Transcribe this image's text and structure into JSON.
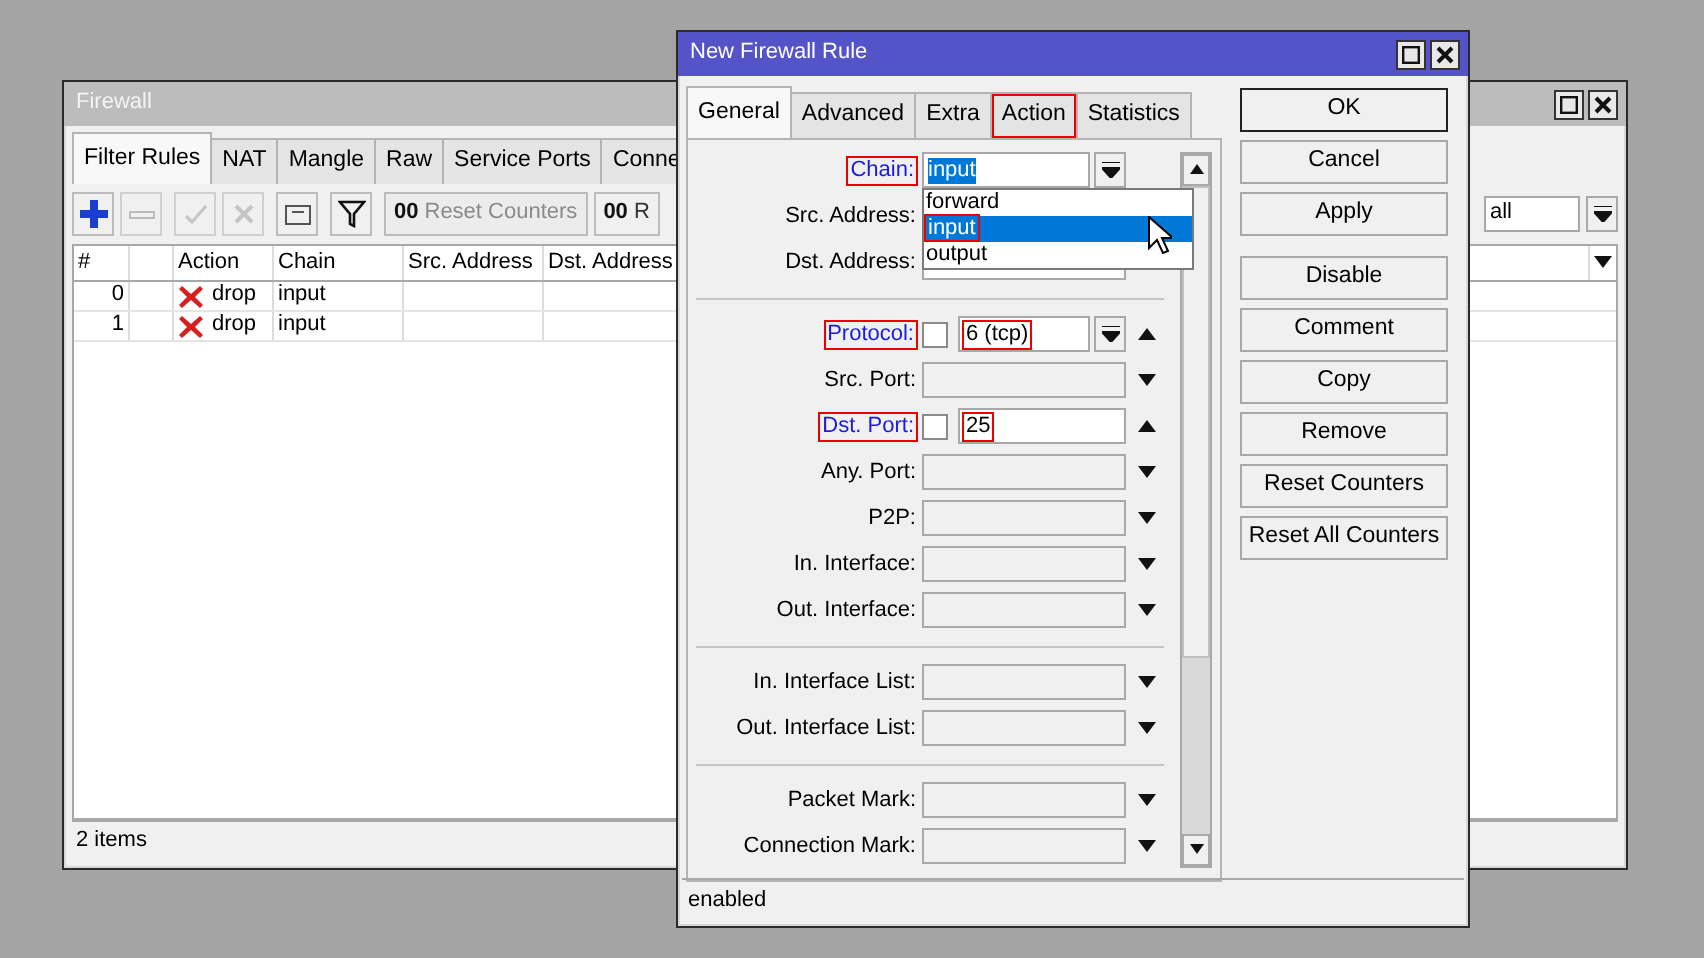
{
  "firewall_window": {
    "title": "Firewall",
    "tabs": [
      {
        "label": "Filter Rules",
        "selected": true
      },
      {
        "label": "NAT",
        "selected": false
      },
      {
        "label": "Mangle",
        "selected": false
      },
      {
        "label": "Raw",
        "selected": false
      },
      {
        "label": "Service Ports",
        "selected": false
      },
      {
        "label": "Conne",
        "selected": false
      }
    ],
    "toolbar": [
      {
        "kind": "add",
        "disabled": false
      },
      {
        "kind": "remove",
        "disabled": true
      },
      {
        "kind": "enable",
        "disabled": true
      },
      {
        "kind": "disable",
        "disabled": true
      },
      {
        "kind": "comment",
        "disabled": false
      },
      {
        "kind": "filter",
        "disabled": false
      }
    ],
    "counter_buttons": [
      {
        "prefix": "00",
        "label": "Reset Counters",
        "disabled": true
      },
      {
        "prefix": "00",
        "label": "R",
        "disabled": false
      }
    ],
    "filter_value": "all",
    "table": {
      "columns": [
        "#",
        "Action",
        "Chain",
        "Src. Address",
        "Dst. Address"
      ],
      "rows": [
        {
          "number": "0",
          "action": "drop",
          "chain": "input"
        },
        {
          "number": "1",
          "action": "drop",
          "chain": "input"
        }
      ]
    },
    "status": "2 items"
  },
  "dialog": {
    "title": "New Firewall Rule",
    "tabs": [
      {
        "label": "General",
        "selected": true,
        "highlighted": false
      },
      {
        "label": "Advanced",
        "selected": false,
        "highlighted": false
      },
      {
        "label": "Extra",
        "selected": false,
        "highlighted": false
      },
      {
        "label": "Action",
        "selected": false,
        "highlighted": true
      },
      {
        "label": "Statistics",
        "selected": false,
        "highlighted": false
      }
    ],
    "sections": [
      [
        {
          "kind": "select",
          "label": "Chain:",
          "active": true,
          "highlighted": true,
          "value": "input",
          "value_selected": true,
          "options": [
            {
              "label": "forward",
              "selected": false,
              "highlighted": false
            },
            {
              "label": "input",
              "selected": true,
              "highlighted": true
            },
            {
              "label": "output",
              "selected": false,
              "highlighted": false
            }
          ]
        },
        {
          "kind": "text",
          "label": "Src. Address:",
          "active": false,
          "highlighted": false
        },
        {
          "kind": "text",
          "label": "Dst. Address:",
          "active": false,
          "highlighted": false
        }
      ],
      [
        {
          "kind": "negatable-select",
          "label": "Protocol:",
          "active": true,
          "highlighted": true,
          "negated": false,
          "value": "6 (tcp)",
          "value_highlighted": true,
          "expanded": true
        },
        {
          "kind": "collapsed",
          "label": "Src. Port:",
          "active": false,
          "highlighted": false,
          "expanded": false
        },
        {
          "kind": "negatable-text",
          "label": "Dst. Port:",
          "active": true,
          "highlighted": true,
          "negated": false,
          "value": "25",
          "value_highlighted": true,
          "expanded": true
        },
        {
          "kind": "collapsed",
          "label": "Any. Port:",
          "active": false,
          "highlighted": false,
          "expanded": false
        },
        {
          "kind": "collapsed",
          "label": "P2P:",
          "active": false,
          "highlighted": false,
          "expanded": false
        },
        {
          "kind": "collapsed",
          "label": "In. Interface:",
          "active": false,
          "highlighted": false,
          "expanded": false
        },
        {
          "kind": "collapsed",
          "label": "Out. Interface:",
          "active": false,
          "highlighted": false,
          "expanded": false
        }
      ],
      [
        {
          "kind": "collapsed",
          "label": "In. Interface List:",
          "active": false,
          "highlighted": false,
          "expanded": false
        },
        {
          "kind": "collapsed",
          "label": "Out. Interface List:",
          "active": false,
          "highlighted": false,
          "expanded": false
        }
      ],
      [
        {
          "kind": "collapsed",
          "label": "Packet Mark:",
          "active": false,
          "highlighted": false,
          "expanded": false
        },
        {
          "kind": "collapsed",
          "label": "Connection Mark:",
          "active": false,
          "highlighted": false,
          "expanded": false
        }
      ]
    ],
    "buttons": [
      {
        "label": "OK",
        "default": true
      },
      {
        "label": "Cancel",
        "default": false
      },
      {
        "label": "Apply",
        "default": false
      }
    ],
    "actions": [
      "Disable",
      "Comment",
      "Copy",
      "Remove",
      "Reset Counters",
      "Reset All Counters"
    ],
    "status": "enabled"
  }
}
